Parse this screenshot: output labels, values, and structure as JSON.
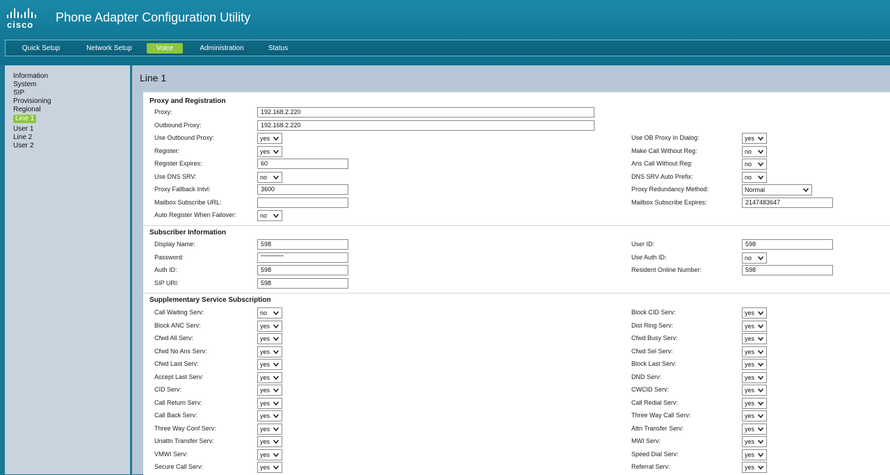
{
  "header": {
    "title": "Phone Adapter Configuration Utility",
    "logo_text": "cisco",
    "logo_icon": "cisco-bars-icon"
  },
  "nav": {
    "items": [
      {
        "label": "Quick Setup",
        "active": false
      },
      {
        "label": "Network Setup",
        "active": false
      },
      {
        "label": "Voice",
        "active": true
      },
      {
        "label": "Administration",
        "active": false
      },
      {
        "label": "Status",
        "active": false
      }
    ]
  },
  "sidebar": {
    "items": [
      {
        "label": "Information",
        "active": false
      },
      {
        "label": "System",
        "active": false
      },
      {
        "label": "SIP",
        "active": false
      },
      {
        "label": "Provisioning",
        "active": false
      },
      {
        "label": "Regional",
        "active": false
      },
      {
        "label": "Line 1",
        "active": true
      },
      {
        "label": "User 1",
        "active": false
      },
      {
        "label": "Line 2",
        "active": false
      },
      {
        "label": "User 2",
        "active": false
      }
    ]
  },
  "page": {
    "title": "Line 1"
  },
  "sections": {
    "proxy": {
      "title": "Proxy and Registration",
      "left": [
        {
          "label": "Proxy:",
          "type": "input",
          "value": "192.168.2.220",
          "wide": true
        },
        {
          "label": "Outbound Proxy:",
          "type": "input",
          "value": "192.168.2.220",
          "wide": true
        },
        {
          "label": "Use Outbound Proxy:",
          "type": "select",
          "value": "yes"
        },
        {
          "label": "Register:",
          "type": "select",
          "value": "yes"
        },
        {
          "label": "Register Expires:",
          "type": "input",
          "value": "60"
        },
        {
          "label": "Use DNS SRV:",
          "type": "select",
          "value": "no"
        },
        {
          "label": "Proxy Fallback Intvl:",
          "type": "input",
          "value": "3600"
        },
        {
          "label": "Mailbox Subscribe URL:",
          "type": "input",
          "value": ""
        },
        {
          "label": "Auto Register When Failover:",
          "type": "select",
          "value": "no"
        }
      ],
      "right": [
        {
          "label": "Use OB Proxy In Dialog:",
          "type": "select",
          "value": "yes"
        },
        {
          "label": "Make Call Without Reg:",
          "type": "select",
          "value": "no"
        },
        {
          "label": "Ans Call Without Reg:",
          "type": "select",
          "value": "no"
        },
        {
          "label": "DNS SRV Auto Prefix:",
          "type": "select",
          "value": "no"
        },
        {
          "label": "Proxy Redundancy Method:",
          "type": "select",
          "value": "Normal",
          "wide": true
        },
        {
          "label": "Mailbox Subscribe Expires:",
          "type": "input",
          "value": "2147483647"
        }
      ]
    },
    "subscriber": {
      "title": "Subscriber Information",
      "left": [
        {
          "label": "Display Name:",
          "type": "input",
          "value": "598"
        },
        {
          "label": "Password:",
          "type": "input",
          "value": "**************",
          "password": true
        },
        {
          "label": "Auth ID:",
          "type": "input",
          "value": "598"
        },
        {
          "label": "SIP URI:",
          "type": "input",
          "value": "598"
        }
      ],
      "right": [
        {
          "label": "User ID:",
          "type": "input",
          "value": "598"
        },
        {
          "label": "Use Auth ID:",
          "type": "select",
          "value": "no"
        },
        {
          "label": "Resident Online Number:",
          "type": "input",
          "value": "598"
        }
      ]
    },
    "supplementary": {
      "title": "Supplementary Service Subscription",
      "left": [
        {
          "label": "Call Waiting Serv:",
          "value": "no"
        },
        {
          "label": "Block ANC Serv:",
          "value": "yes"
        },
        {
          "label": "Cfwd All Serv:",
          "value": "yes"
        },
        {
          "label": "Cfwd No Ans Serv:",
          "value": "yes"
        },
        {
          "label": "Cfwd Last Serv:",
          "value": "yes"
        },
        {
          "label": "Accept Last Serv:",
          "value": "yes"
        },
        {
          "label": "CID Serv:",
          "value": "yes"
        },
        {
          "label": "Call Return Serv:",
          "value": "yes"
        },
        {
          "label": "Call Back Serv:",
          "value": "yes"
        },
        {
          "label": "Three Way Conf Serv:",
          "value": "yes"
        },
        {
          "label": "Unattn Transfer Serv:",
          "value": "yes"
        },
        {
          "label": "VMWI Serv:",
          "value": "yes"
        },
        {
          "label": "Secure Call Serv:",
          "value": "yes"
        }
      ],
      "right": [
        {
          "label": "Block CID Serv:",
          "value": "yes"
        },
        {
          "label": "Dist Ring Serv:",
          "value": "yes"
        },
        {
          "label": "Cfwd Busy Serv:",
          "value": "yes"
        },
        {
          "label": "Cfwd Sel Serv:",
          "value": "yes"
        },
        {
          "label": "Block Last Serv:",
          "value": "yes"
        },
        {
          "label": "DND Serv:",
          "value": "yes"
        },
        {
          "label": "CWCID Serv:",
          "value": "yes"
        },
        {
          "label": "Call Redial Serv:",
          "value": "yes"
        },
        {
          "label": "Three Way Call Serv:",
          "value": "yes"
        },
        {
          "label": "Attn Transfer Serv:",
          "value": "yes"
        },
        {
          "label": "MWI Serv:",
          "value": "yes"
        },
        {
          "label": "Speed Dial Serv:",
          "value": "yes"
        },
        {
          "label": "Referral Serv:",
          "value": "yes"
        }
      ]
    }
  }
}
